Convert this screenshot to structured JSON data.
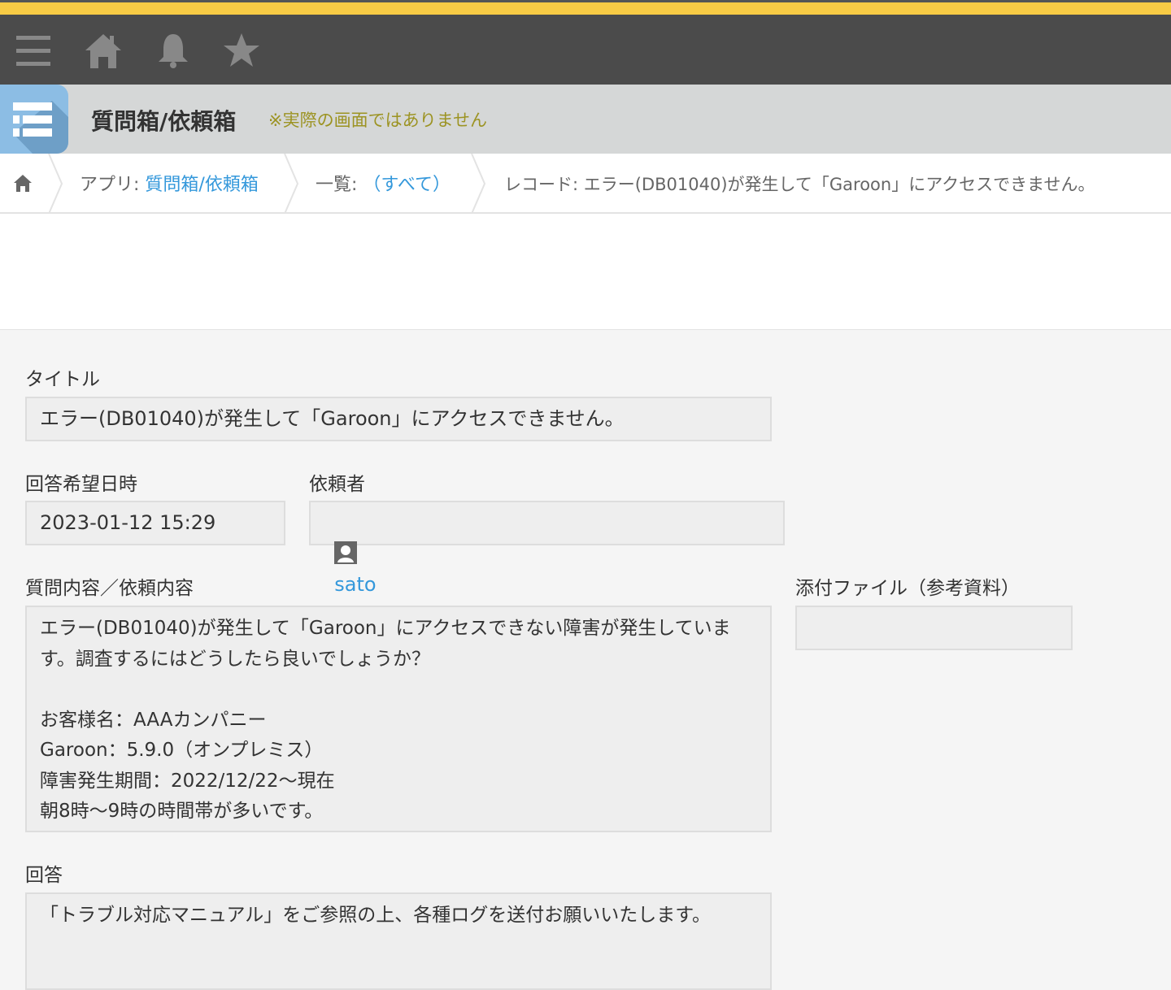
{
  "topbar": {
    "icons": [
      "menu-icon",
      "home-icon",
      "bell-icon",
      "star-icon"
    ]
  },
  "app": {
    "title": "質問箱/依頼箱",
    "notice": "※実際の画面ではありません"
  },
  "breadcrumb": {
    "app_prefix": "アプリ: ",
    "app_link": "質問箱/依頼箱",
    "list_prefix": "一覧: ",
    "list_link": "（すべて）",
    "record": "レコード: エラー(DB01040)が発生して「Garoon」にアクセスできません。"
  },
  "record": {
    "title_label": "タイトル",
    "title_value": "エラー(DB01040)が発生して「Garoon」にアクセスできません。",
    "date_label": "回答希望日時",
    "date_value": "2023-01-12 15:29",
    "requester_label": "依頼者",
    "requester_value": "sato",
    "content_label": "質問内容／依頼内容",
    "content_value": "エラー(DB01040)が発生して「Garoon」にアクセスできない障害が発生しています。調査するにはどうしたら良いでしょうか？\n\nお客様名：AAAカンパニー\nGaroon：5.9.0（オンプレミス）\n障害発生期間：2022/12/22〜現在\n朝8時〜9時の時間帯が多いです。",
    "attachment_label": "添付ファイル（参考資料）",
    "answer_label": "回答",
    "answer_value": "「トラブル対応マニュアル」をご参照の上、各種ログを送付お願いいたします。"
  },
  "colors": {
    "accent": "#f8cb45",
    "link": "#3498db",
    "notice": "#9c9322"
  }
}
